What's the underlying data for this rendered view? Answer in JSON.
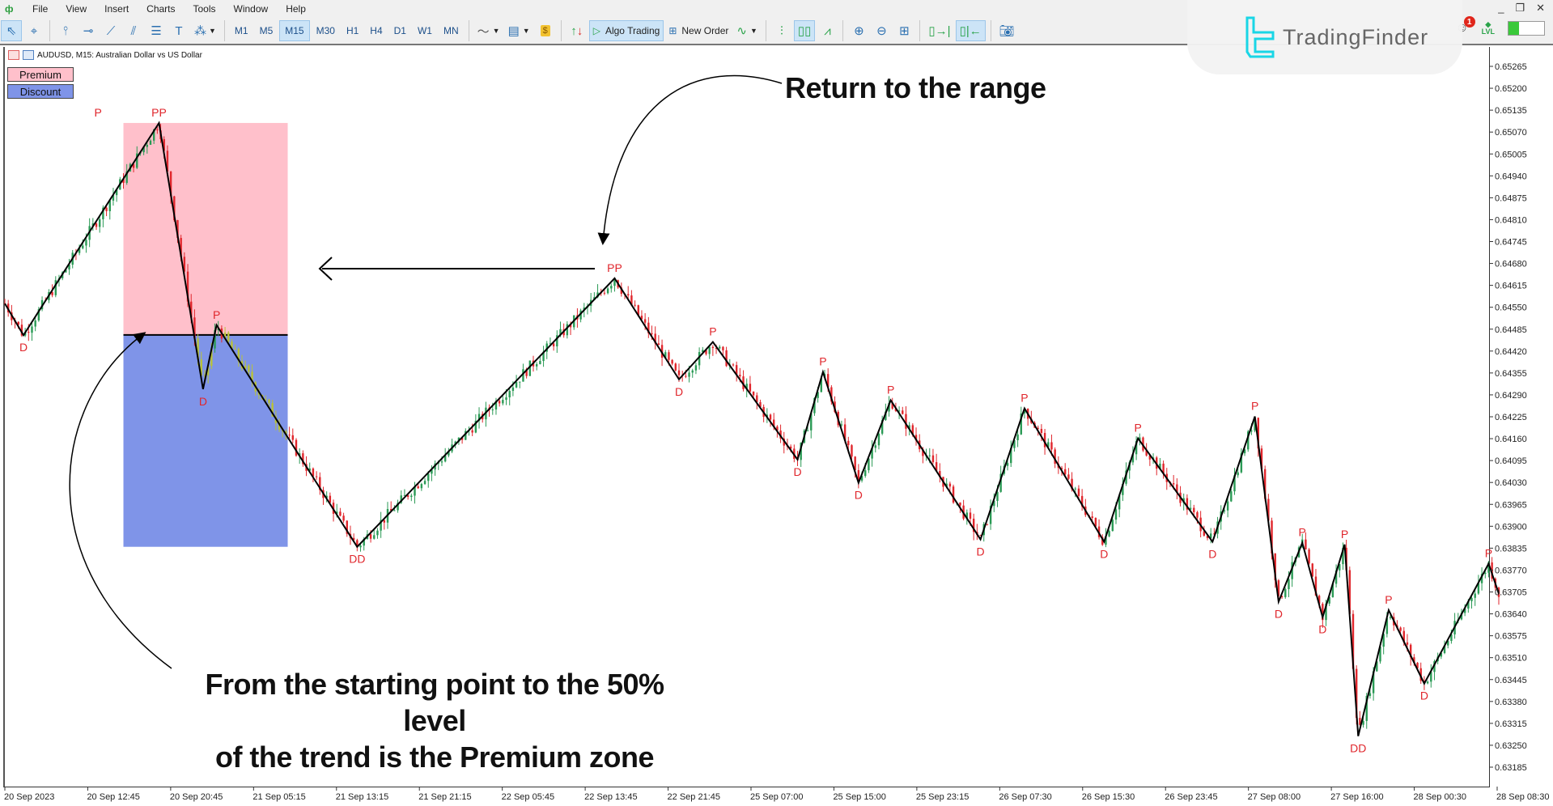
{
  "menu": {
    "items": [
      "File",
      "View",
      "Insert",
      "Charts",
      "Tools",
      "Window",
      "Help"
    ]
  },
  "window_controls": {
    "minimize": "_",
    "restore": "❐",
    "close": "✕"
  },
  "toolbar": {
    "timeframes": [
      "M1",
      "M5",
      "M15",
      "M30",
      "H1",
      "H4",
      "D1",
      "W1",
      "MN"
    ],
    "active_timeframe": "M15",
    "algo_trading_label": "Algo Trading",
    "new_order_label": "New Order"
  },
  "status": {
    "notification_count": "1",
    "lvl_label": "LVL",
    "signal_strength": 0.3
  },
  "brand": {
    "name": "TradingFinder",
    "accent": "#19d6e6"
  },
  "chart_header": {
    "symbol_line": "AUDUSD, M15:  Australian Dollar vs US Dollar",
    "premium_label": "Premium",
    "discount_label": "Discount"
  },
  "annotations": {
    "top": "Return to the range",
    "bottom_line1": "From the starting point to the 50% level",
    "bottom_line2": "of the trend is the Premium zone"
  },
  "colors": {
    "premium": "#ffc0cb",
    "discount": "#7f94e8",
    "bull": "#2a9a55",
    "bear": "#e0262c",
    "in_zone_candle": "#b8c23a",
    "zigzag": "#000000",
    "pivot_label": "#e0262c"
  },
  "chart_data": {
    "type": "line",
    "title": "AUDUSD, M15: Australian Dollar vs US Dollar",
    "xlabel": "",
    "ylabel": "",
    "ylim": [
      0.6315,
      0.6531
    ],
    "y_ticks": [
      "0.65265",
      "0.65200",
      "0.65135",
      "0.65070",
      "0.65005",
      "0.64940",
      "0.64875",
      "0.64810",
      "0.64745",
      "0.64680",
      "0.64615",
      "0.64550",
      "0.64485",
      "0.64420",
      "0.64355",
      "0.64290",
      "0.64225",
      "0.64160",
      "0.64095",
      "0.64030",
      "0.63965",
      "0.63900",
      "0.63835",
      "0.63770",
      "0.63705",
      "0.63640",
      "0.63575",
      "0.63510",
      "0.63445",
      "0.63380",
      "0.63315",
      "0.63250",
      "0.63185"
    ],
    "x_ticks": [
      "20 Sep 2023",
      "20 Sep 12:45",
      "20 Sep 20:45",
      "21 Sep 05:15",
      "21 Sep 13:15",
      "21 Sep 21:15",
      "22 Sep 05:45",
      "22 Sep 13:45",
      "22 Sep 21:45",
      "25 Sep 07:00",
      "25 Sep 15:00",
      "25 Sep 23:15",
      "26 Sep 07:30",
      "26 Sep 15:30",
      "26 Sep 23:45",
      "27 Sep 08:00",
      "27 Sep 16:00",
      "28 Sep 00:30",
      "28 Sep 08:30"
    ],
    "x_range_bars": [
      0,
      740
    ],
    "zigzag": [
      {
        "bar": 0,
        "price": 0.64561,
        "label": ""
      },
      {
        "bar": 11,
        "price": 0.64467,
        "label": "D"
      },
      {
        "bar": 91,
        "price": 0.65097,
        "label": "PP"
      },
      {
        "bar": 117,
        "price": 0.64307,
        "label": "D"
      },
      {
        "bar": 125,
        "price": 0.64497,
        "label": "P"
      },
      {
        "bar": 208,
        "price": 0.63839,
        "label": "DD"
      },
      {
        "bar": 360,
        "price": 0.64636,
        "label": "PP"
      },
      {
        "bar": 398,
        "price": 0.64336,
        "label": "D"
      },
      {
        "bar": 418,
        "price": 0.64447,
        "label": "P"
      },
      {
        "bar": 468,
        "price": 0.64098,
        "label": "D"
      },
      {
        "bar": 483,
        "price": 0.64358,
        "label": "P"
      },
      {
        "bar": 504,
        "price": 0.64029,
        "label": "D"
      },
      {
        "bar": 523,
        "price": 0.64274,
        "label": "P"
      },
      {
        "bar": 576,
        "price": 0.63861,
        "label": "D"
      },
      {
        "bar": 602,
        "price": 0.6425,
        "label": "P"
      },
      {
        "bar": 649,
        "price": 0.63854,
        "label": "D"
      },
      {
        "bar": 669,
        "price": 0.64161,
        "label": "P"
      },
      {
        "bar": 713,
        "price": 0.63854,
        "label": "D"
      },
      {
        "bar": 738,
        "price": 0.64226,
        "label": "P"
      },
      {
        "bar": 752,
        "price": 0.63676,
        "label": "D"
      },
      {
        "bar": 766,
        "price": 0.63851,
        "label": "P"
      },
      {
        "bar": 778,
        "price": 0.6363,
        "label": "D"
      },
      {
        "bar": 791,
        "price": 0.63846,
        "label": "P"
      },
      {
        "bar": 799,
        "price": 0.63277,
        "label": "DD"
      },
      {
        "bar": 817,
        "price": 0.63651,
        "label": "P"
      },
      {
        "bar": 838,
        "price": 0.63433,
        "label": "D"
      },
      {
        "bar": 876,
        "price": 0.63789,
        "label": "P"
      },
      {
        "bar": 882,
        "price": 0.637,
        "label": ""
      }
    ],
    "zones": {
      "premium": {
        "from_bar": 70,
        "to_bar": 167,
        "top": 0.65097,
        "bottom": 0.64468
      },
      "discount": {
        "from_bar": 70,
        "to_bar": 167,
        "top": 0.64468,
        "bottom": 0.63839
      },
      "equilibrium": 0.64468
    },
    "extra_labels": [
      {
        "bar": 55,
        "price": 0.65097,
        "label": "P"
      }
    ]
  }
}
